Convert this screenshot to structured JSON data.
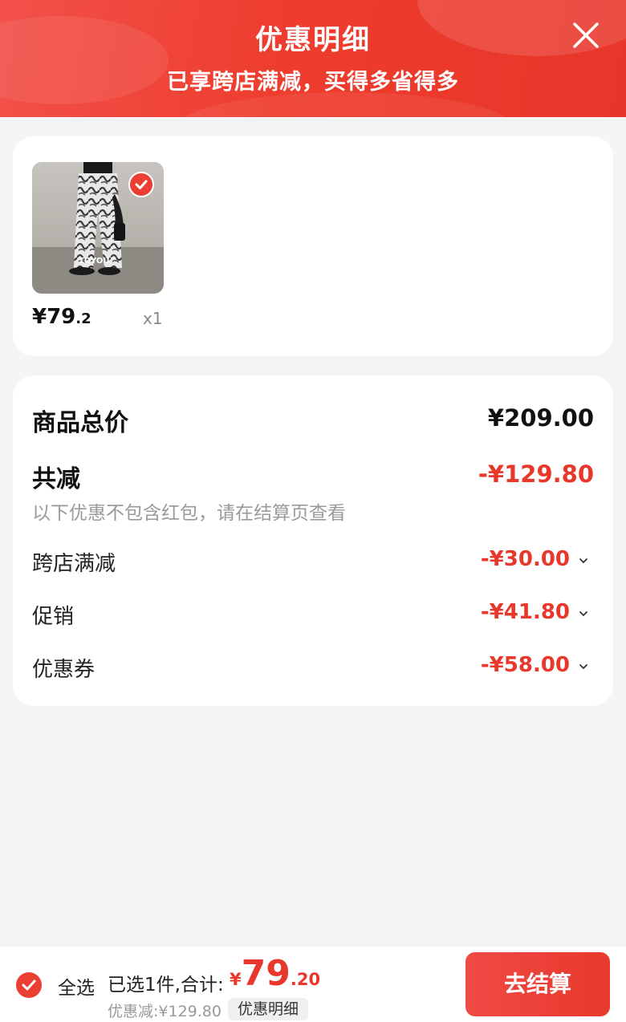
{
  "header": {
    "title": "优惠明细",
    "subtitle": "已享跨店满减，买得多省得多",
    "close_icon": "close-icon"
  },
  "product": {
    "price_int": "¥79",
    "price_dec": ".2",
    "quantity": "x1",
    "thumb_logo": "TOYOU™",
    "selected": true
  },
  "summary": {
    "total_label": "商品总价",
    "total_value": "¥209.00",
    "reduce_label": "共减",
    "reduce_value": "-¥129.80",
    "note": "以下优惠不包含红包，请在结算页查看",
    "details": [
      {
        "label": "跨店满减",
        "value": "-¥30.00"
      },
      {
        "label": "促销",
        "value": "-¥41.80"
      },
      {
        "label": "优惠券",
        "value": "-¥58.00"
      }
    ]
  },
  "bottom_bar": {
    "select_all_label": "全选",
    "selected_text": "已选1件,合计:",
    "total_yen": "¥",
    "total_int": "79",
    "total_dec": ".20",
    "saving_text": "优惠减:¥129.80",
    "detail_pill": "优惠明细",
    "checkout_label": "去结算"
  },
  "colors": {
    "accent": "#e8382c",
    "header_bg": "#ee3d2e",
    "page_bg": "#f5f5f5"
  }
}
